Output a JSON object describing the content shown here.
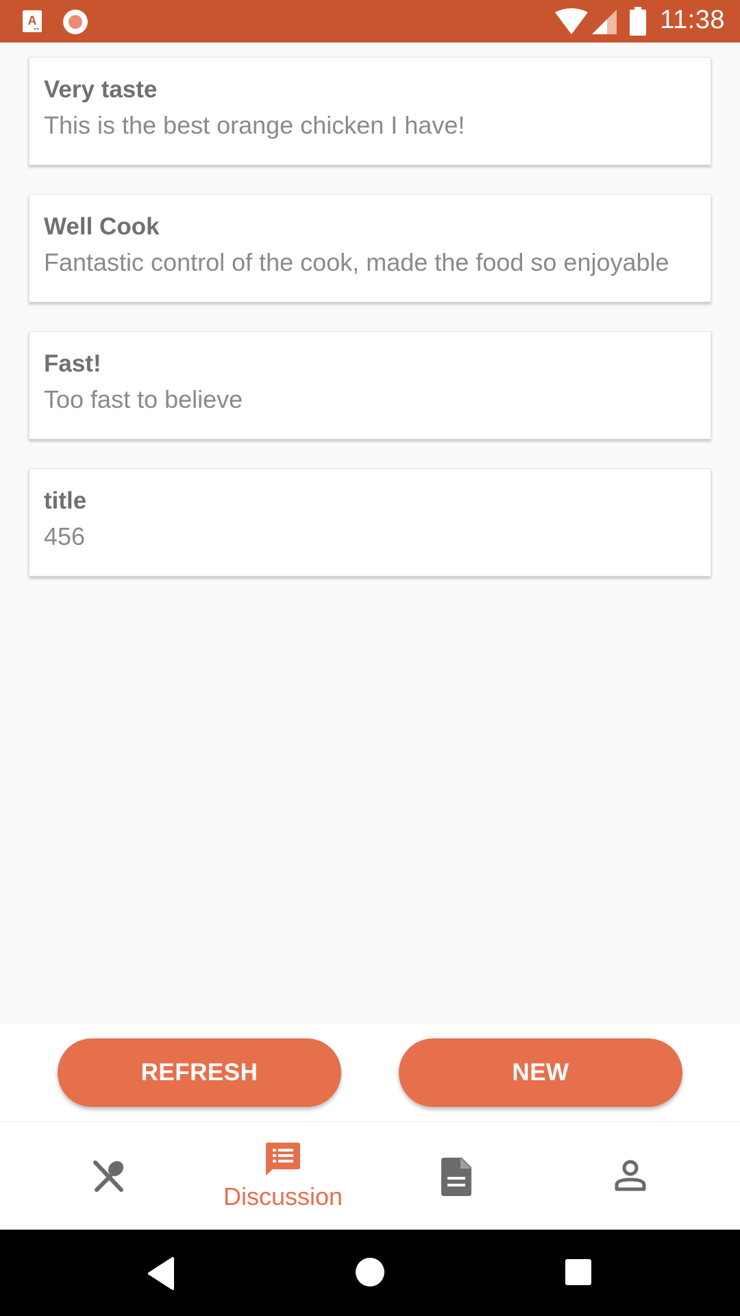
{
  "status_bar": {
    "time": "11:38",
    "icons": [
      "app-a-notification-icon",
      "record-notification-icon",
      "wifi-icon",
      "signal-icon",
      "battery-icon"
    ],
    "background": "#c9552f"
  },
  "reviews": [
    {
      "title": "Very taste",
      "body": "This is the best orange chicken I have!"
    },
    {
      "title": "Well Cook",
      "body": "Fantastic control of the cook, made the food so enjoyable"
    },
    {
      "title": "Fast!",
      "body": "Too fast to believe"
    },
    {
      "title": "title",
      "body": "456"
    }
  ],
  "actions": {
    "refresh_label": "REFRESH",
    "new_label": "NEW"
  },
  "bottom_nav": {
    "items": [
      {
        "icon": "fork-spoon-icon",
        "label": ""
      },
      {
        "icon": "discussion-icon",
        "label": "Discussion",
        "active": true
      },
      {
        "icon": "document-icon",
        "label": ""
      },
      {
        "icon": "profile-icon",
        "label": ""
      }
    ]
  },
  "system_nav": {
    "icons": [
      "back-icon",
      "home-icon",
      "recents-icon"
    ]
  },
  "colors": {
    "accent": "#e6704c",
    "status_bar": "#c9552f",
    "inactive_icon": "#6b6b6b"
  }
}
